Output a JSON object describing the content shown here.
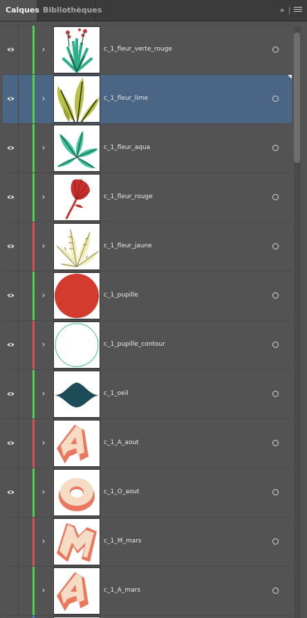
{
  "tabs": [
    {
      "label": "Calques",
      "active": true
    },
    {
      "label": "Bibliothèques",
      "active": false
    }
  ],
  "header": {
    "collapse_icon": "double-chevron-right-icon",
    "menu_icon": "panel-menu-icon"
  },
  "colors": {
    "green": "#4bd64b",
    "red": "#e24b4b",
    "selection": "#4b6584",
    "panel": "#535353"
  },
  "layers": [
    {
      "name": "c_1_fleur_verte_rouge",
      "visible": true,
      "color": "#4bd64b",
      "selected": false,
      "icon": "plant-red-flower-thumbnail"
    },
    {
      "name": "c_1_fleur_lime",
      "visible": true,
      "color": "#4bd64b",
      "selected": true,
      "icon": "lime-leaves-thumbnail"
    },
    {
      "name": "c_1_fleur_aqua",
      "visible": true,
      "color": "#4bd64b",
      "selected": false,
      "icon": "aqua-leaves-thumbnail"
    },
    {
      "name": "c_1_fleur_rouge",
      "visible": true,
      "color": "#4bd64b",
      "selected": false,
      "icon": "red-fan-flower-thumbnail"
    },
    {
      "name": "c_1_fleur_jaune",
      "visible": true,
      "color": "#e24b4b",
      "selected": false,
      "icon": "yellow-fern-thumbnail"
    },
    {
      "name": "c_1_pupille",
      "visible": true,
      "color": "#4bd64b",
      "selected": false,
      "icon": "red-circle-thumbnail"
    },
    {
      "name": "c_1_pupille_contour",
      "visible": true,
      "color": "#e24b4b",
      "selected": false,
      "icon": "circle-outline-thumbnail"
    },
    {
      "name": "c_1_oeil",
      "visible": true,
      "color": "#4bd64b",
      "selected": false,
      "icon": "eye-shape-thumbnail"
    },
    {
      "name": "c_1_A_aout",
      "visible": true,
      "color": "#e24b4b",
      "selected": false,
      "icon": "letter-a-3d-thumbnail"
    },
    {
      "name": "c_1_O_aout",
      "visible": true,
      "color": "#4bd64b",
      "selected": false,
      "icon": "letter-o-3d-thumbnail"
    },
    {
      "name": "c_1_M_mars",
      "visible": false,
      "color": "#e24b4b",
      "selected": false,
      "icon": "letter-m-3d-thumbnail"
    },
    {
      "name": "c_1_A_mars",
      "visible": false,
      "color": "#4bd64b",
      "selected": false,
      "icon": "letter-a-3d-thumbnail"
    }
  ]
}
